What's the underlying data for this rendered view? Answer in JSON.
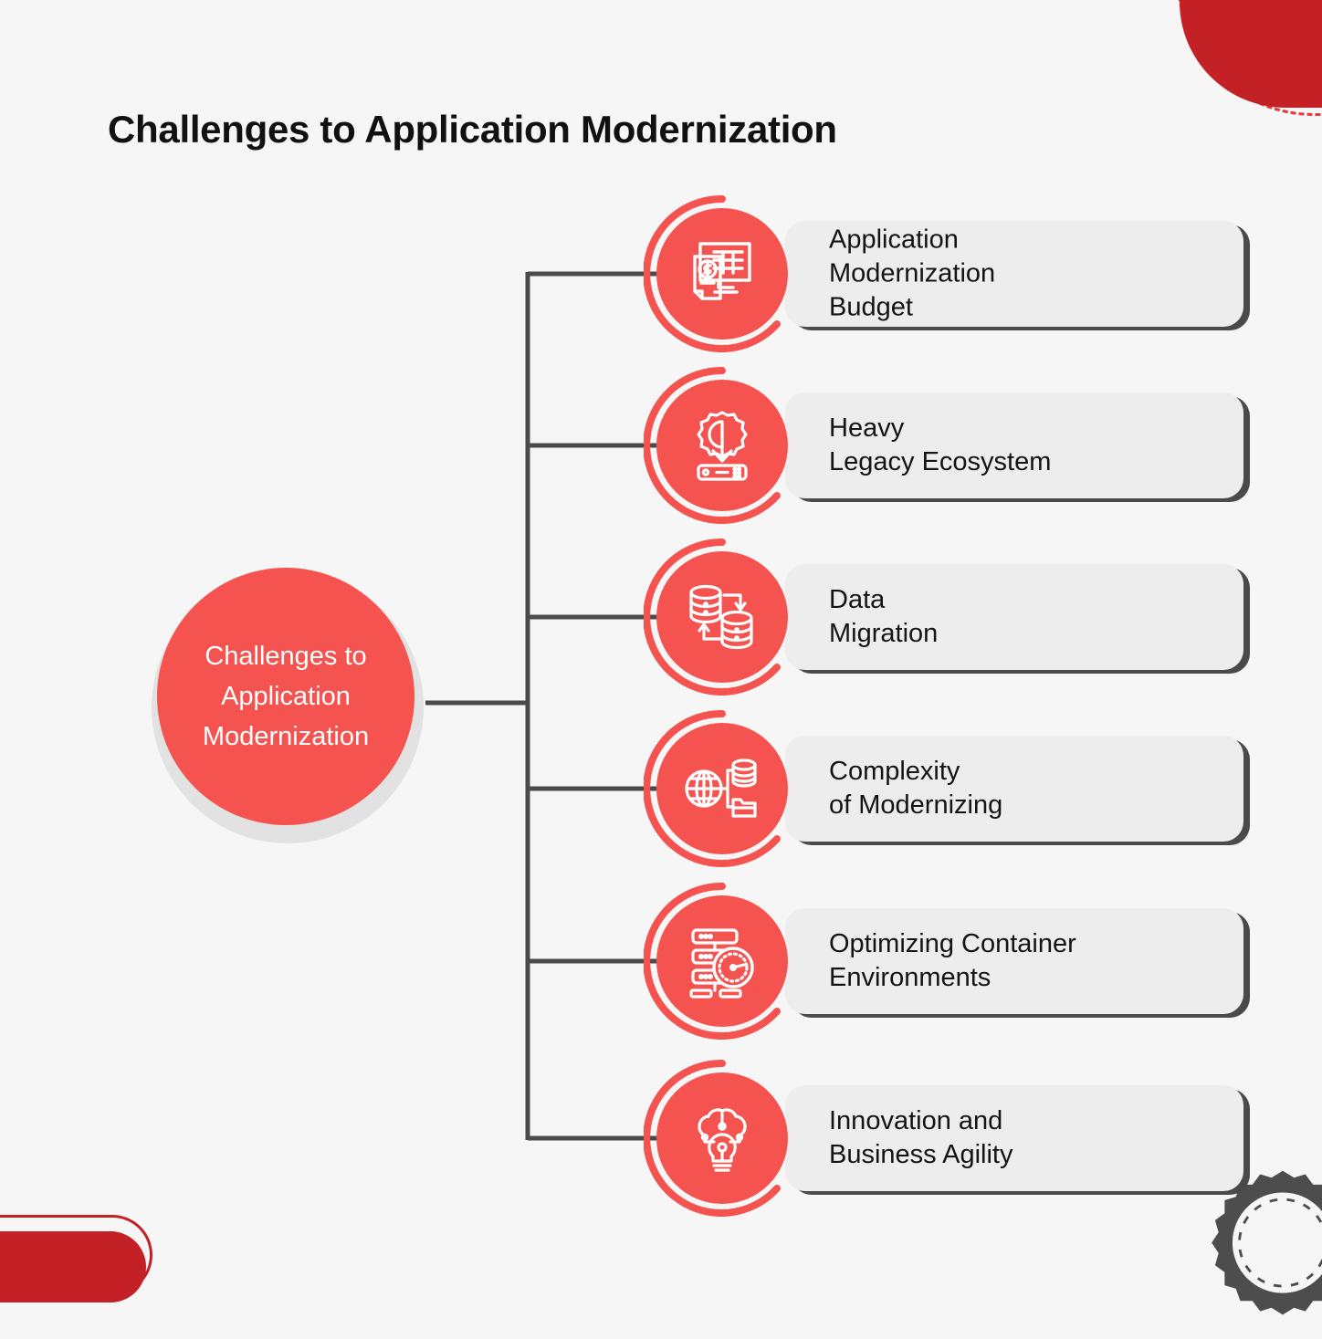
{
  "page": {
    "title": "Challenges to Application Modernization",
    "background_color": "#f6f6f6",
    "accent_color": "#f5534f",
    "dark_accent_color": "#c42127",
    "line_color": "#4a4a4a",
    "pill_color": "#ededed"
  },
  "hub": {
    "label": "Challenges to\nApplication\nModernization",
    "fill_color": "#f5534f",
    "text_color": "#ffffff"
  },
  "items": [
    {
      "index": 1,
      "label": "Application\nModernization\nBudget",
      "icon": "invoice-monitor-icon"
    },
    {
      "index": 2,
      "label": "Heavy\nLegacy Ecosystem",
      "icon": "gear-download-server-icon"
    },
    {
      "index": 3,
      "label": "Data\nMigration",
      "icon": "database-transfer-icon"
    },
    {
      "index": 4,
      "label": "Complexity\nof Modernizing",
      "icon": "globe-database-folder-icon"
    },
    {
      "index": 5,
      "label": "Optimizing Container\nEnvironments",
      "icon": "server-gauge-icon"
    },
    {
      "index": 6,
      "label": "Innovation and\nBusiness Agility",
      "icon": "brain-lightbulb-icon"
    }
  ],
  "decorations": [
    {
      "name": "top-right-quarter-circle",
      "color": "#c42127"
    },
    {
      "name": "top-right-dashed-arc",
      "color": "#e8353c"
    },
    {
      "name": "bottom-left-rounded-bar",
      "color": "#c42127"
    },
    {
      "name": "bottom-right-gear",
      "color": "#4a4a4a"
    }
  ]
}
